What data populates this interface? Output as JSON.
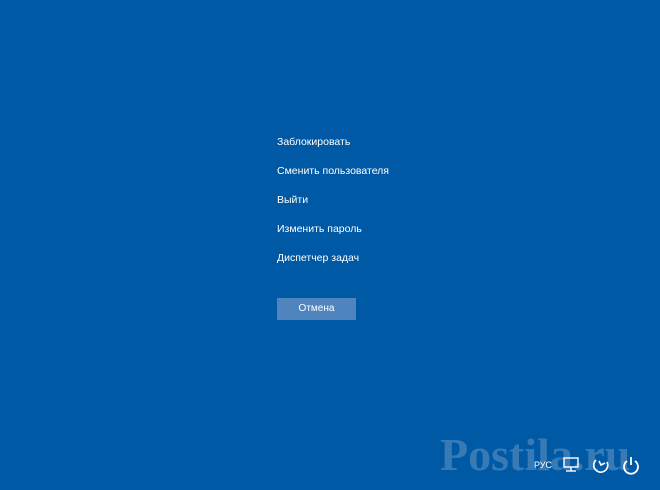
{
  "menu": {
    "items": [
      {
        "id": "lock",
        "label": "Заблокировать"
      },
      {
        "id": "switch-user",
        "label": "Сменить пользователя"
      },
      {
        "id": "sign-out",
        "label": "Выйти"
      },
      {
        "id": "change-password",
        "label": "Изменить пароль"
      },
      {
        "id": "task-manager",
        "label": "Диспетчер задач"
      }
    ]
  },
  "cancel_label": "Отмена",
  "tray": {
    "language": "РУС",
    "icons": [
      "network-icon",
      "accessibility-icon",
      "power-icon"
    ]
  },
  "watermark": {
    "text": "Postila.ru"
  },
  "colors": {
    "background": "#0059a4",
    "button": "#4f84bf",
    "text": "#ffffff"
  }
}
